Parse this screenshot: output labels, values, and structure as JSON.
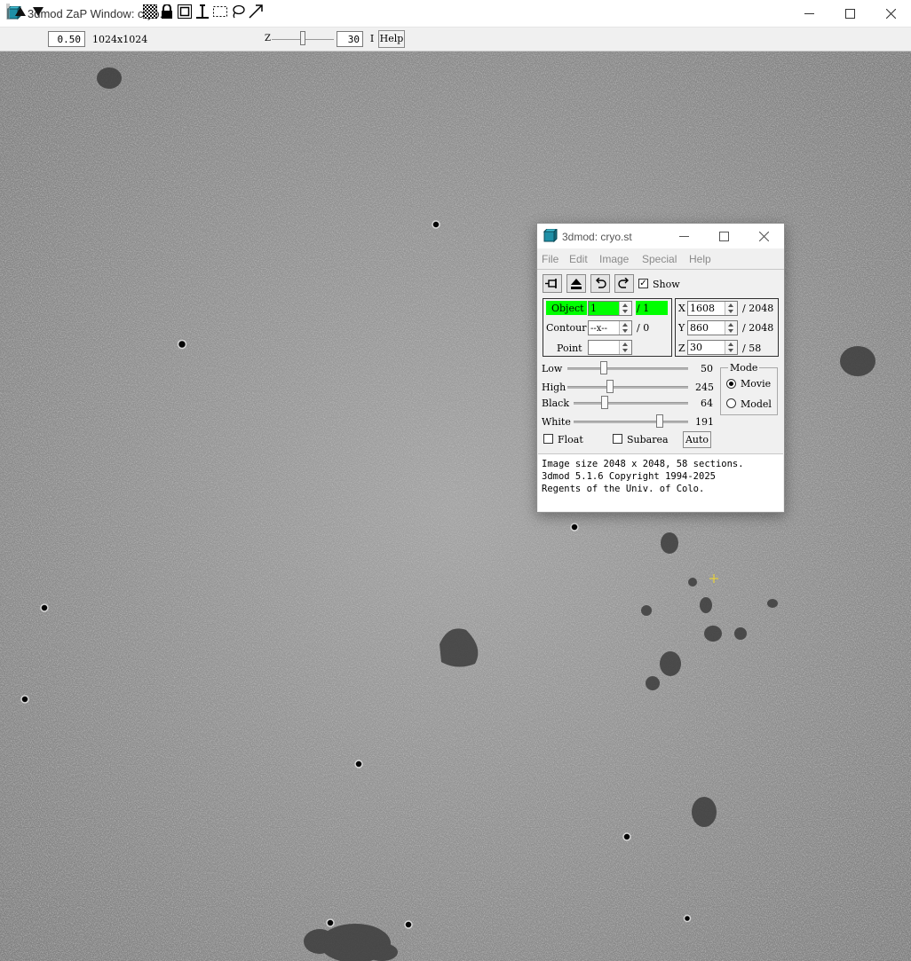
{
  "zap_window": {
    "title": "3dmod ZaP Window: cryo.st",
    "toolbar": {
      "zoom_value": "0.50",
      "image_size_label": "1024x1024",
      "z_label": "Z",
      "z_value": "30",
      "interpolate_label": "I",
      "help_label": "Help"
    },
    "icons": [
      "grip-icon",
      "arrow-up-icon",
      "arrow-down-icon",
      "checkerboard-icon",
      "lock-icon",
      "rectangle-icon",
      "cursor-pin-icon",
      "rubberband-icon",
      "lasso-icon",
      "arrow-tool-icon"
    ]
  },
  "info_window": {
    "title": "3dmod: cryo.st",
    "menu": [
      "File",
      "Edit",
      "Image",
      "Special",
      "Help"
    ],
    "show_label": "Show",
    "show_checked": true,
    "object": {
      "label": "Object",
      "value": "1",
      "total": "/ 1"
    },
    "contour": {
      "label": "Contour",
      "value": "--x--",
      "total": "/ 0"
    },
    "point": {
      "label": "Point",
      "value": ""
    },
    "coords": {
      "x": {
        "label": "X",
        "value": "1608",
        "total": "/ 2048"
      },
      "y": {
        "label": "Y",
        "value": "860",
        "total": "/ 2048"
      },
      "z": {
        "label": "Z",
        "value": "30",
        "total": "/ 58"
      }
    },
    "sliders": [
      {
        "label": "Low",
        "value": "50",
        "fraction": 0.3
      },
      {
        "label": "High",
        "value": "245",
        "fraction": 0.35
      },
      {
        "label": "Black",
        "value": "64",
        "fraction": 0.27
      },
      {
        "label": "White",
        "value": "191",
        "fraction": 0.75
      }
    ],
    "mode": {
      "title": "Mode",
      "options": [
        "Movie",
        "Model"
      ],
      "selected": "Movie"
    },
    "float_label": "Float",
    "subarea_label": "Subarea",
    "auto_label": "Auto",
    "messages": [
      "Image size 2048 x 2048, 58 sections.",
      "3dmod 5.1.6 Copyright 1994-2025",
      "Regents of the Univ. of Colo."
    ]
  },
  "colors": {
    "object_highlight": "#00ff00",
    "micrograph_gray": "#8f8f8f",
    "cursor_marker": "#e8d23a"
  }
}
